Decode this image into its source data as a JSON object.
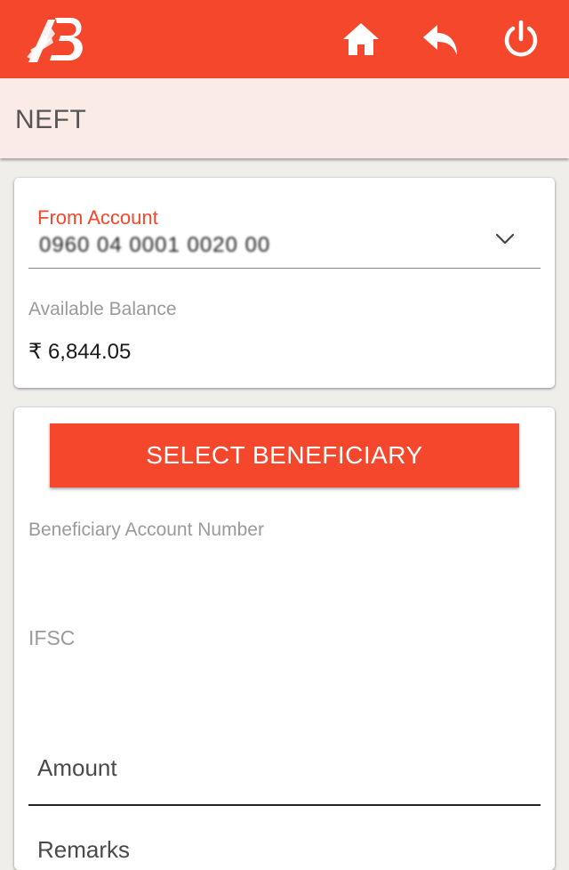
{
  "header": {
    "icons": [
      "bank-logo",
      "home-icon",
      "back-icon",
      "power-icon"
    ]
  },
  "page": {
    "title": "NEFT"
  },
  "from_account": {
    "label": "From Account",
    "value": "0960 04 0001 0020 00",
    "available_balance_label": "Available Balance",
    "available_balance": "₹ 6,844.05"
  },
  "beneficiary": {
    "select_button_label": "SELECT BENEFICIARY",
    "account_number_label": "Beneficiary Account Number",
    "ifsc_label": "IFSC",
    "amount_placeholder": "Amount",
    "remarks_placeholder": "Remarks"
  },
  "colors": {
    "accent": "#f4472c",
    "title_bar_bg": "#fbebe7",
    "background": "#efeeea"
  }
}
